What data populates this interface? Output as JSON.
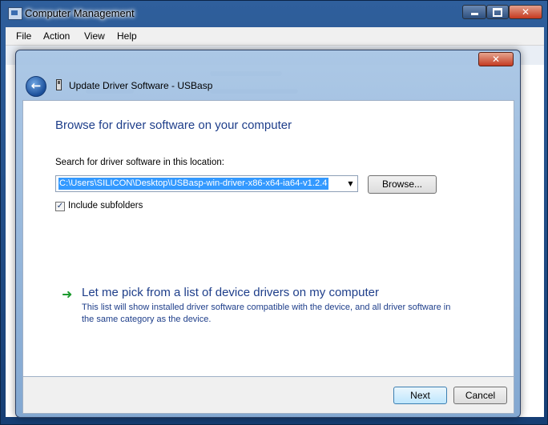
{
  "outer_window": {
    "title": "Computer Management",
    "menu": [
      "File",
      "Action",
      "View",
      "Help"
    ],
    "controls": {
      "minimize": "minimize",
      "maximize": "maximize",
      "close": "✕"
    }
  },
  "dialog": {
    "title": "Update Driver Software - USBasp",
    "close_label": "✕",
    "heading": "Browse for driver software on your computer",
    "search_label": "Search for driver software in this location:",
    "path_value": "C:\\Users\\SILICON\\Desktop\\USBasp-win-driver-x86-x64-ia64-v1.2.4",
    "browse_label": "Browse...",
    "include_subfolders_label": "Include subfolders",
    "include_subfolders_checked": true,
    "pick_title": "Let me pick from a list of device drivers on my computer",
    "pick_description": "This list will show installed driver software compatible with the device, and all driver software in the same category as the device.",
    "next_label": "Next",
    "cancel_label": "Cancel"
  },
  "icons": {
    "back": "back-arrow-icon",
    "device": "usb-device-icon",
    "pick": "green-arrow-icon",
    "checkbox_mark": "✓"
  },
  "colors": {
    "heading": "#1e3e8a",
    "selection": "#3399ff",
    "link_arrow": "#1c9a2e"
  }
}
